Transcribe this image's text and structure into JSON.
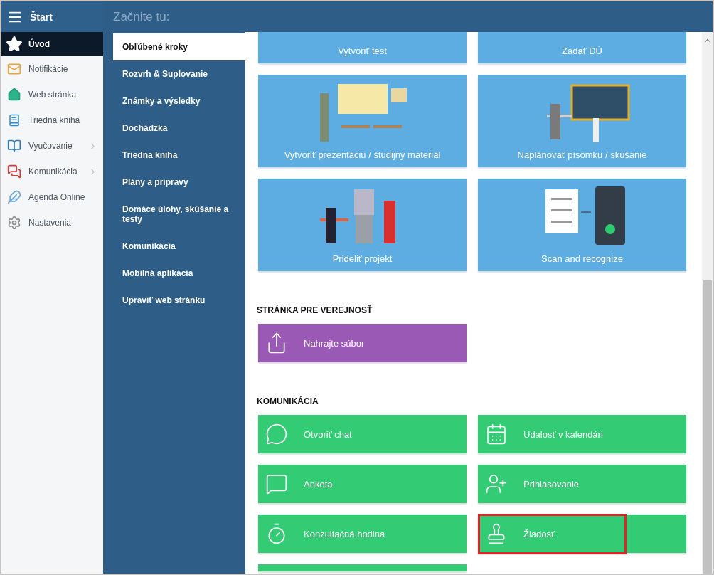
{
  "header": {
    "menu_title": "Štart",
    "page_title": "Začnite tu:"
  },
  "sidebar": {
    "items": [
      {
        "label": "Úvod",
        "selected": true,
        "expandable": false
      },
      {
        "label": "Notifikácie",
        "selected": false,
        "expandable": false
      },
      {
        "label": "Web stránka",
        "selected": false,
        "expandable": false
      },
      {
        "label": "Triedna kniha",
        "selected": false,
        "expandable": false
      },
      {
        "label": "Vyučovanie",
        "selected": false,
        "expandable": true
      },
      {
        "label": "Komunikácia",
        "selected": false,
        "expandable": true
      },
      {
        "label": "Agenda Online",
        "selected": false,
        "expandable": false
      },
      {
        "label": "Nastavenia",
        "selected": false,
        "expandable": false
      }
    ]
  },
  "steps_menu": {
    "items": [
      {
        "label": "Obľúbené kroky",
        "selected": true
      },
      {
        "label": "Rozvrh & Suplovanie",
        "selected": false
      },
      {
        "label": "Známky a výsledky",
        "selected": false
      },
      {
        "label": "Dochádzka",
        "selected": false
      },
      {
        "label": "Triedna kniha",
        "selected": false
      },
      {
        "label": "Plány a prípravy",
        "selected": false
      },
      {
        "label": "Domáce úlohy, skúšanie a testy",
        "selected": false
      },
      {
        "label": "Komunikácia",
        "selected": false
      },
      {
        "label": "Mobilná aplikácia",
        "selected": false
      },
      {
        "label": "Upraviť web stránku",
        "selected": false
      }
    ]
  },
  "sections": [
    {
      "color": "#5dade2",
      "kind": "illustrated",
      "tiles": [
        {
          "label": "Vytvoriť test",
          "cropped": true
        },
        {
          "label": "Zadať DÚ",
          "cropped": true
        },
        {
          "label": "Vytvoriť prezentáciu / študijný materiál",
          "cropped": false
        },
        {
          "label": "Naplánovať písomku / skúšanie",
          "cropped": false
        },
        {
          "label": "Prideliť projekt",
          "cropped": false
        },
        {
          "label": "Scan and recognize",
          "cropped": false
        }
      ]
    },
    {
      "title": "STRÁNKA PRE VEREJNOSŤ",
      "color": "#9b59b6",
      "kind": "icon",
      "tiles": [
        {
          "label": "Nahrajte súbor",
          "cropped": false,
          "highlighted": false
        }
      ]
    },
    {
      "title": "KOMUNIKÁCIA",
      "color": "#33cc74",
      "kind": "icon",
      "tiles": [
        {
          "label": "Otvoriť chat",
          "cropped": false,
          "highlighted": false
        },
        {
          "label": "Udalosť v kalendári",
          "cropped": false,
          "highlighted": false
        },
        {
          "label": "Anketa",
          "cropped": false,
          "highlighted": false
        },
        {
          "label": "Prihlasovanie",
          "cropped": false,
          "highlighted": false
        },
        {
          "label": "Konzultačná hodina",
          "cropped": false,
          "highlighted": false
        },
        {
          "label": "Žiadosť",
          "cropped": false,
          "highlighted": true
        },
        {
          "cropped": true,
          "highlighted": false
        }
      ]
    }
  ]
}
